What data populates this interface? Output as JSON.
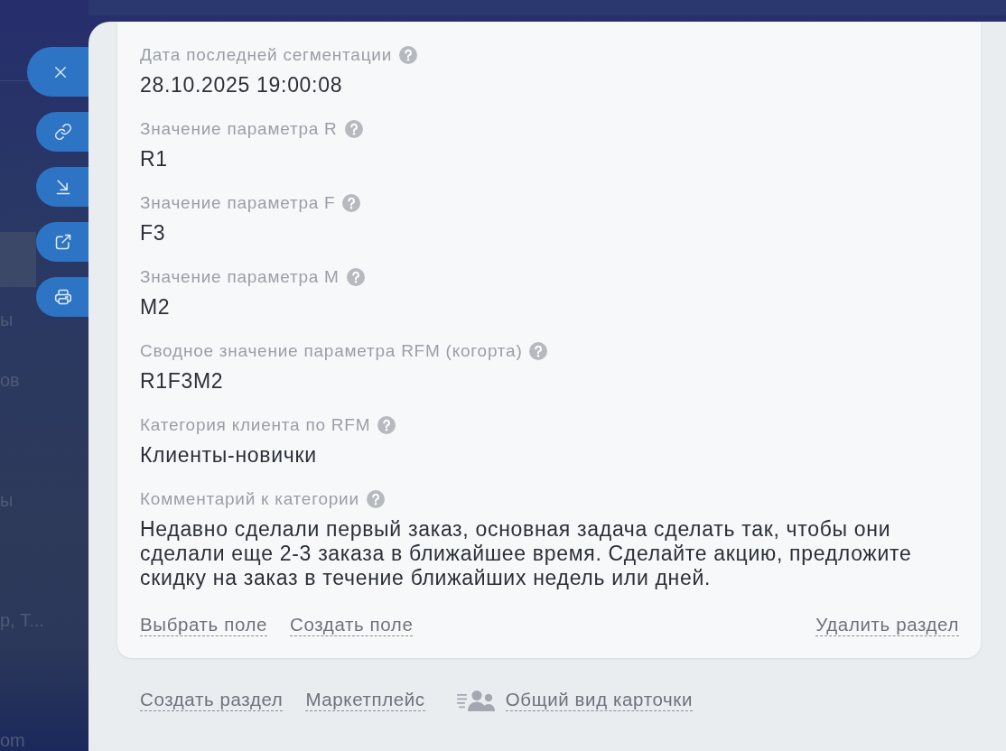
{
  "sidebar": {
    "items": [
      {
        "selected": true
      },
      {
        "label": "ы",
        "selected": false
      },
      {
        "label": "ов",
        "selected": false
      },
      {
        "selected": false
      },
      {
        "label": "ы",
        "selected": false
      },
      {
        "selected": false
      },
      {
        "label": "р, Т...",
        "selected": false
      },
      {
        "selected": false
      },
      {
        "label": "om",
        "selected": false
      }
    ]
  },
  "panel_actions": [
    {
      "kind": "close"
    },
    {
      "kind": "link"
    },
    {
      "kind": "download"
    },
    {
      "kind": "open_external"
    },
    {
      "kind": "print"
    }
  ],
  "section": {
    "fields": [
      {
        "label": "Дата последней сегментации",
        "help": true,
        "value": "28.10.2025 19:00:08"
      },
      {
        "label": "Значение параметра R",
        "help": true,
        "value": "R1"
      },
      {
        "label": "Значение параметра F",
        "help": true,
        "value": "F3"
      },
      {
        "label": "Значение параметра M",
        "help": true,
        "value": "M2"
      },
      {
        "label": "Сводное значение параметра RFM (когорта)",
        "help": true,
        "value": "R1F3M2"
      },
      {
        "label": "Категория клиента по RFM",
        "help": true,
        "value": "Клиенты-новички"
      },
      {
        "label": "Комментарий к категории",
        "help": true,
        "value": "Недавно сделали первый заказ, основная задача сделать так, чтобы они сделали еще 2-3 заказа в ближайшее время. Сделайте акцию, предложите скидку на заказ в течение ближайших недель или дней."
      }
    ],
    "left_actions": [
      "Выбрать поле",
      "Создать поле"
    ],
    "right_actions": [
      "Удалить раздел"
    ]
  },
  "footer_links": [
    {
      "label": "Создать раздел",
      "kind": "text"
    },
    {
      "label": "Маркетплейс",
      "kind": "text"
    },
    {
      "label": "Общий вид карточки",
      "kind": "icon"
    }
  ]
}
